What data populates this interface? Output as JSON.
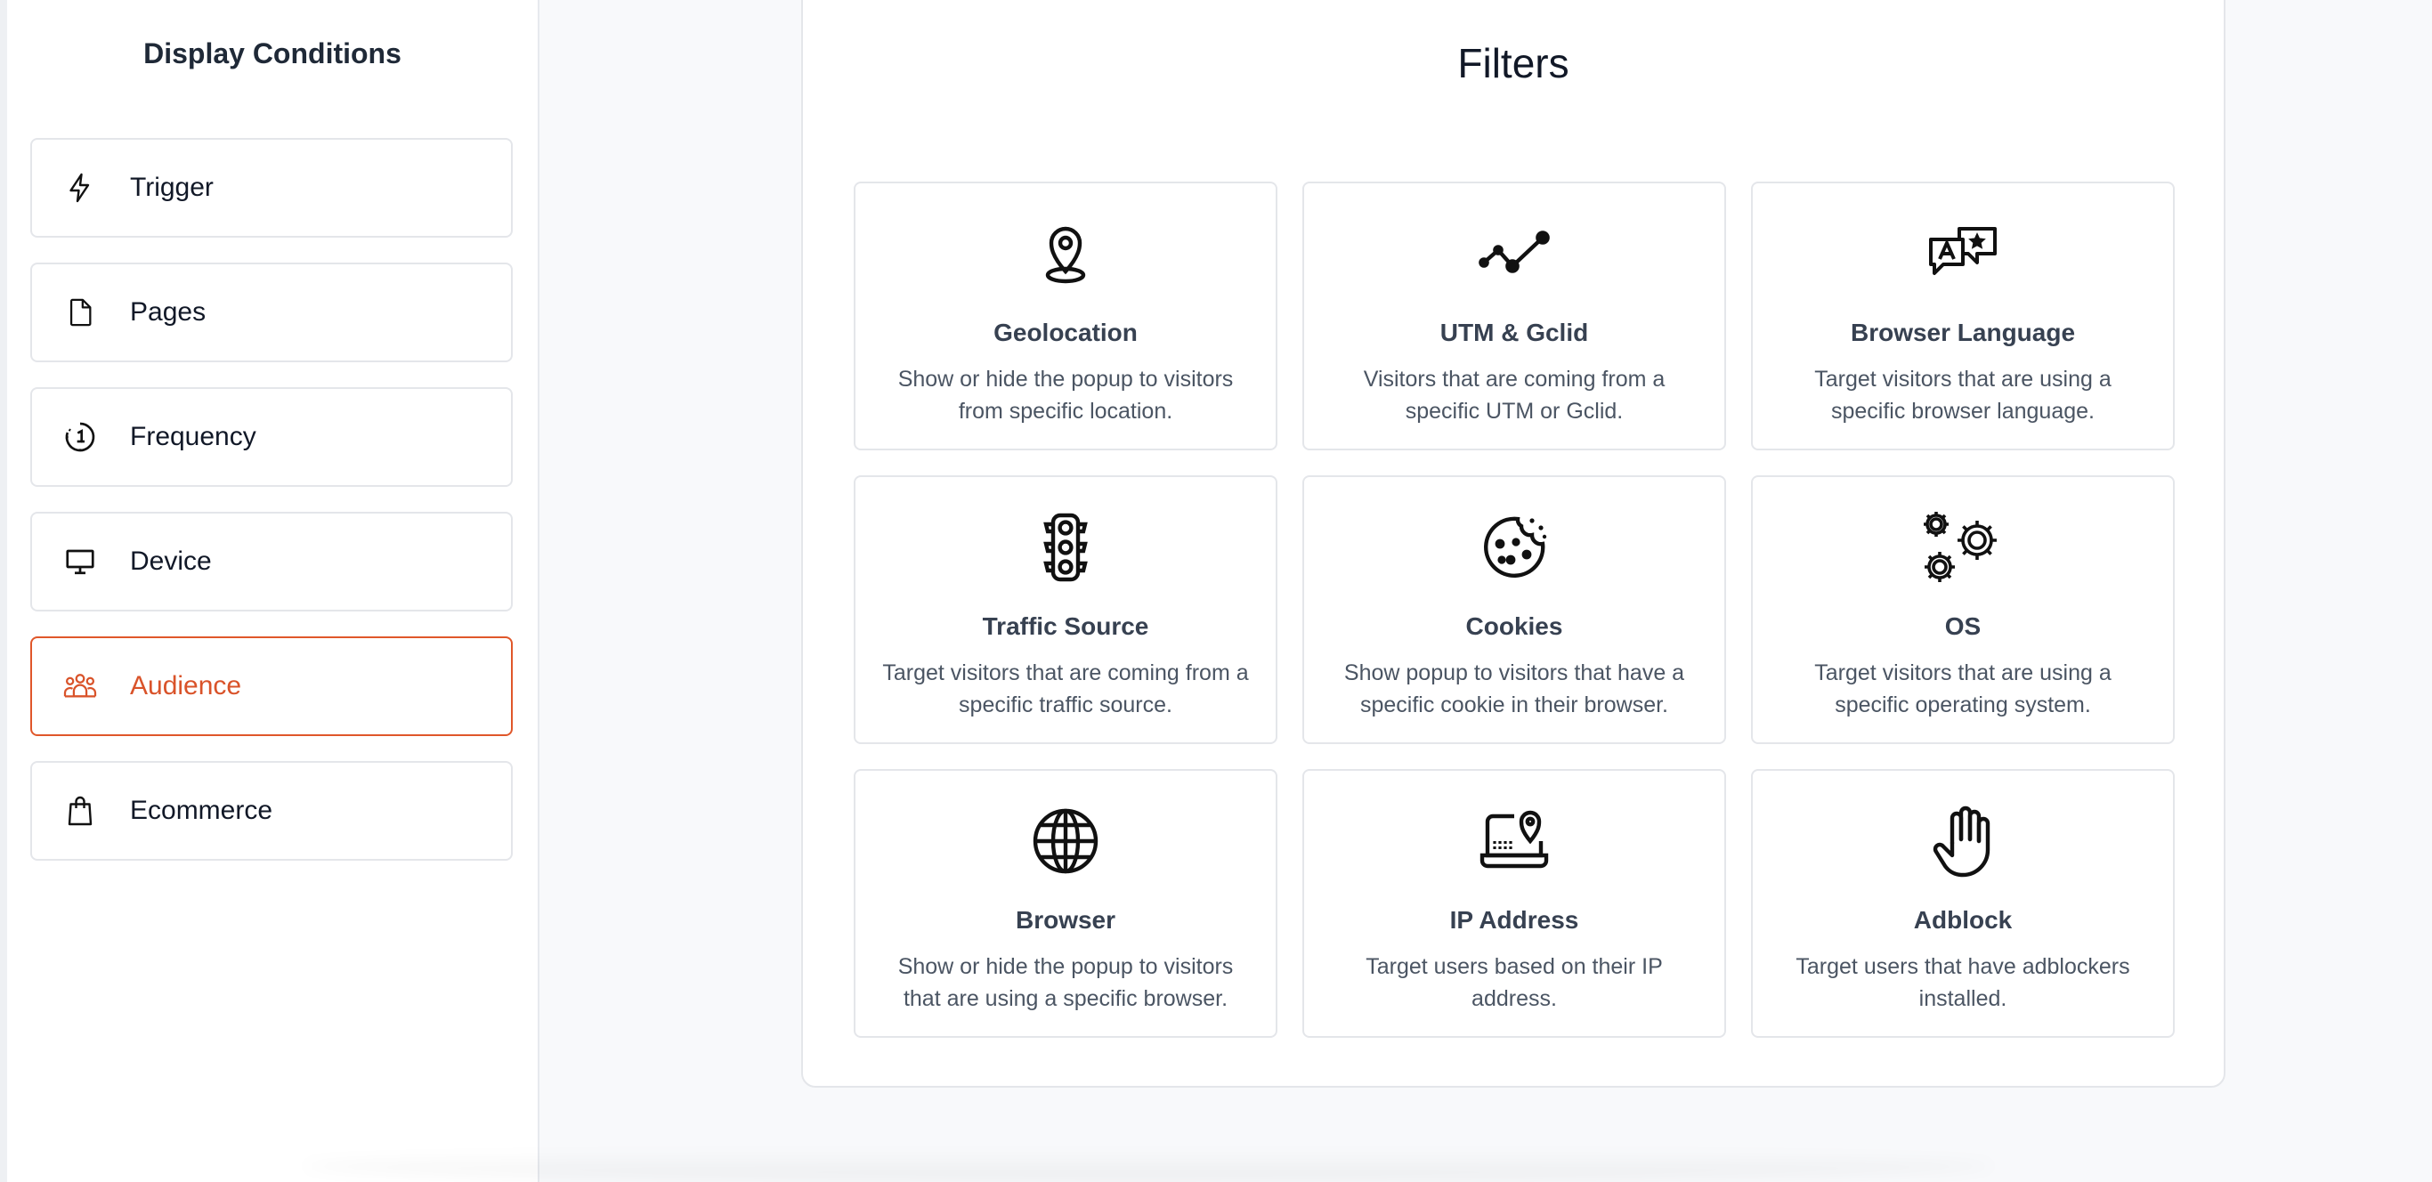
{
  "sidebar": {
    "title": "Display Conditions",
    "items": [
      {
        "label": "Trigger",
        "icon": "lightning-icon"
      },
      {
        "label": "Pages",
        "icon": "file-icon"
      },
      {
        "label": "Frequency",
        "icon": "timer-icon"
      },
      {
        "label": "Device",
        "icon": "monitor-icon"
      },
      {
        "label": "Audience",
        "icon": "users-icon",
        "active": true
      },
      {
        "label": "Ecommerce",
        "icon": "shopping-bag-icon"
      }
    ]
  },
  "filters": {
    "title": "Filters",
    "cards": [
      {
        "title": "Geolocation",
        "description": "Show or hide the popup to visitors from specific location.",
        "icon": "map-pin-icon"
      },
      {
        "title": "UTM & Gclid",
        "description": "Visitors that are coming from a specific UTM or Gclid.",
        "icon": "line-chart-icon"
      },
      {
        "title": "Browser Language",
        "description": "Target visitors that are using a specific browser language.",
        "icon": "language-icon"
      },
      {
        "title": "Traffic Source",
        "description": "Target visitors that are coming from a specific traffic source.",
        "icon": "traffic-light-icon"
      },
      {
        "title": "Cookies",
        "description": "Show popup to visitors that have a specific cookie in their browser.",
        "icon": "cookie-icon"
      },
      {
        "title": "OS",
        "description": "Target visitors that are using a specific operating system.",
        "icon": "gears-icon"
      },
      {
        "title": "Browser",
        "description": "Show or hide the popup to visitors that are using a specific browser.",
        "icon": "globe-icon"
      },
      {
        "title": "IP Address",
        "description": "Target users based on their IP address.",
        "icon": "ip-location-icon"
      },
      {
        "title": "Adblock",
        "description": "Target users that have adblockers installed.",
        "icon": "hand-icon"
      }
    ]
  },
  "colors": {
    "accent": "#e0572a",
    "border": "#e4e6ea",
    "text": "#374151"
  }
}
